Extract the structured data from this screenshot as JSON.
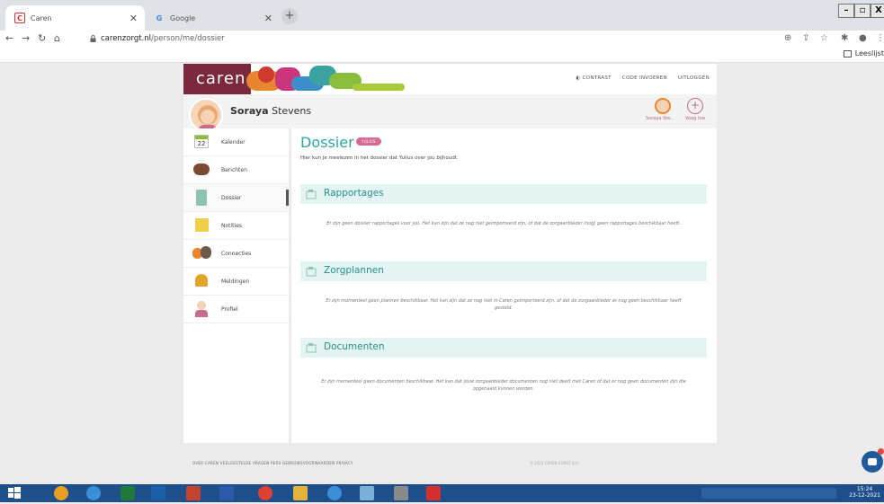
{
  "browser": {
    "tabs": [
      {
        "title": "Caren",
        "active": true
      },
      {
        "title": "Google",
        "active": false
      }
    ],
    "url_domain": "carenzorgt.nl",
    "url_path": "/person/me/dossier",
    "reading_list": "Leeslijst"
  },
  "app": {
    "logo": "caren",
    "toplinks": [
      "CONTRAST",
      "CODE INVOEREN",
      "UITLOGGEN"
    ],
    "user_first": "Soraya",
    "user_last": "Stevens",
    "profile_switch": [
      {
        "label": "Soraya Ste...",
        "icon": "user-avatar-icon"
      },
      {
        "label": "Voeg toe",
        "icon": "plus-circle-icon"
      }
    ],
    "calendar_day": "22",
    "sidebar": [
      {
        "label": "Kalender",
        "icon": "calendar-icon"
      },
      {
        "label": "Berichten",
        "icon": "chat-bubble-icon"
      },
      {
        "label": "Dossier",
        "icon": "clipboard-icon"
      },
      {
        "label": "Notities",
        "icon": "note-icon"
      },
      {
        "label": "Connecties",
        "icon": "people-icon"
      },
      {
        "label": "Meldingen",
        "icon": "bell-icon"
      },
      {
        "label": "Profiel",
        "icon": "person-icon"
      }
    ],
    "main": {
      "title": "Dossier",
      "badge": "YULIUS",
      "subtitle": "Hier kun je meelezen in het dossier dat Yulius over jou bijhoudt.",
      "sections": [
        {
          "title": "Rapportages",
          "text": "Er zijn geen dossier rapportages voor jou. Het kan zijn dat ze nog niet geïmporteerd zijn, of dat de zorgaanbieder (nog) geen rapportages beschikbaar heeft."
        },
        {
          "title": "Zorgplannen",
          "text": "Er zijn momenteel geen plannen beschikbaar. Het kan zijn dat ze nog niet in Caren geïmporteerd zijn, of dat de zorgaanbieder er nog geen beschikbaar heeft gesteld."
        },
        {
          "title": "Documenten",
          "text": "Er zijn momenteel geen documenten beschikbaar. Het kan dat jouw zorgaanbieder documenten nog niet deelt met Caren of dat er nog geen documenten zijn die opgehaald kunnen worden."
        }
      ]
    },
    "footer_links": "OVER CAREN   VEELGESTELDE VRAGEN   PERS   GEBRUIKSVOORWAARDEN   PRIVACY",
    "copyright": "© 2021 CAREN ZORGT B.V."
  },
  "taskbar": {
    "time": "15:24",
    "date": "23-12-2021"
  },
  "colors": {
    "teal": "#2aa6a0",
    "pink": "#d66a96",
    "logo_bg": "#7b2a3e"
  }
}
